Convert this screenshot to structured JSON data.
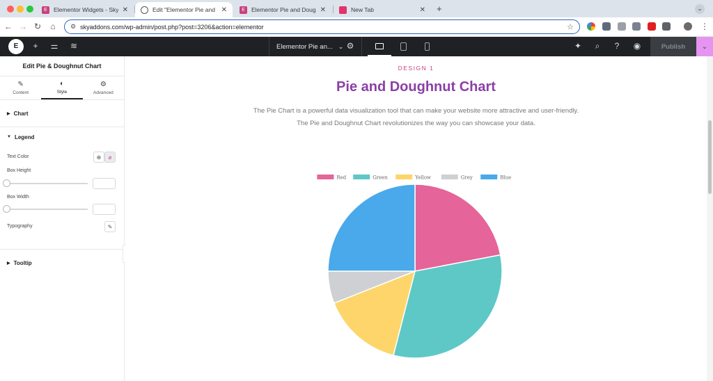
{
  "browser": {
    "tabs": [
      {
        "title": "Elementor Widgets - Sky Add",
        "active": false
      },
      {
        "title": "Edit \"Elementor Pie and Doug",
        "active": true
      },
      {
        "title": "Elementor Pie and Doughnut C",
        "active": false
      },
      {
        "title": "New Tab",
        "active": false
      }
    ],
    "url": "skyaddons.com/wp-admin/post.php?post=3206&action=elementor"
  },
  "editor": {
    "page_name": "Elementor Pie an...",
    "publish_label": "Publish"
  },
  "panel": {
    "title": "Edit Pie & Doughnut Chart",
    "tabs": [
      "Content",
      "Style",
      "Advanced"
    ],
    "sections": {
      "chart": "Chart",
      "legend": "Legend",
      "tooltip": "Tooltip"
    },
    "controls": {
      "text_color": "Text Color",
      "box_height": "Box Height",
      "box_width": "Box Width",
      "typography": "Typography"
    }
  },
  "canvas": {
    "design_label": "DESIGN 1",
    "title": "Pie and Doughnut Chart",
    "desc_line1": "The Pie Chart is a powerful data visualization tool that can make your website more attractive and user-friendly.",
    "desc_line2": "The Pie and Doughnut Chart revolutionizes the way you can showcase your data."
  },
  "chart_data": {
    "type": "pie",
    "categories": [
      "Red",
      "Green",
      "Yellow",
      "Grey",
      "Blue"
    ],
    "values": [
      22,
      32,
      15,
      6,
      25
    ],
    "colors": [
      "#e5649a",
      "#5ec8c6",
      "#fdd56b",
      "#cfd0d4",
      "#4aa9ea"
    ],
    "legend": "top"
  }
}
